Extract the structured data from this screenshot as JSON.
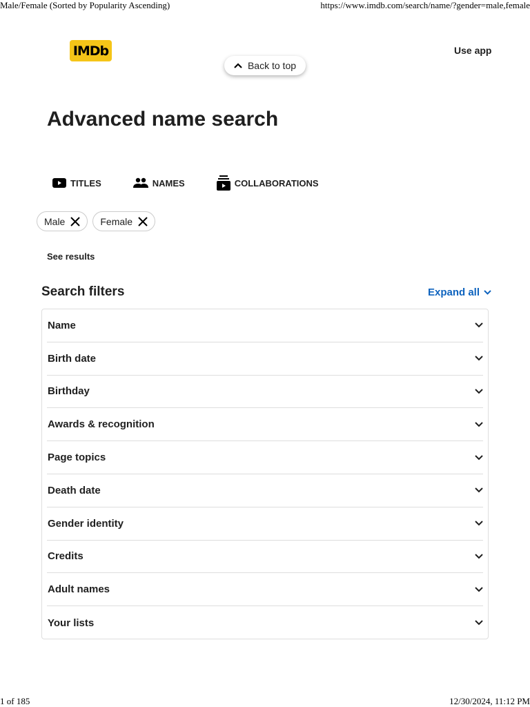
{
  "print_header": {
    "title": "Male/Female (Sorted by Popularity Ascending)",
    "url": "https://www.imdb.com/search/name/?gender=male,female"
  },
  "header": {
    "logo": "IMDb",
    "use_app": "Use app",
    "back_to_top": "Back to top"
  },
  "page_title": "Advanced name search",
  "tabs": [
    {
      "label": "TITLES",
      "icon": "video-icon"
    },
    {
      "label": "NAMES",
      "icon": "people-icon"
    },
    {
      "label": "COLLABORATIONS",
      "icon": "collection-icon"
    }
  ],
  "chips": [
    {
      "label": "Male"
    },
    {
      "label": "Female"
    }
  ],
  "see_results": "See results",
  "filters": {
    "title": "Search filters",
    "expand_all": "Expand all",
    "items": [
      "Name",
      "Birth date",
      "Birthday",
      "Awards & recognition",
      "Page topics",
      "Death date",
      "Gender identity",
      "Credits",
      "Adult names",
      "Your lists"
    ]
  },
  "print_footer": {
    "page": "1 of 185",
    "datetime": "12/30/2024, 11:12 PM"
  },
  "colors": {
    "accent": "#0e63be",
    "logo": "#f5c518"
  }
}
